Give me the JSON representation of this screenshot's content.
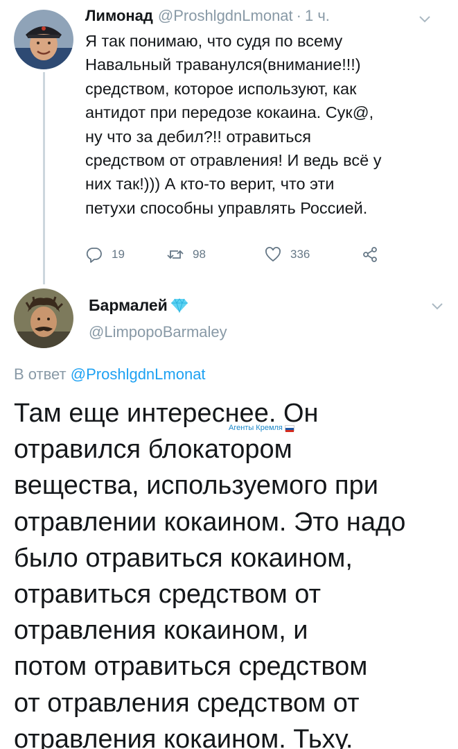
{
  "parent_tweet": {
    "name": "Лимонад",
    "handle": "@ProshlgdnLmonat",
    "separator": "·",
    "time": "1 ч.",
    "text_lines": [
      "Я так понимаю, что судя по всему",
      "Навальный траванулся(внимание!!!)",
      "средством, которое используют, как",
      "антидот при передозе кокаина. Сук@,",
      "ну что за дебил?!! отравиться",
      "средством от отравления! И ведь всё у",
      "них так!))) А кто-то верит, что эти",
      "петухи способны управлять Россией."
    ],
    "actions": {
      "replies": "19",
      "retweets": "98",
      "likes": "336"
    }
  },
  "reply_tweet": {
    "name": "Бармалей",
    "handle": "@LimpopoBarmaley",
    "reply_prefix": "В ответ",
    "reply_handle": "@ProshlgdnLmonat",
    "text_lines": [
      "Там еще интереснее. Он",
      "отравился блокатором",
      "вещества, используемого при",
      "отравлении кокаином. Это надо",
      "было отравиться кокаином,",
      "отравиться средством от",
      "отравления кокаином, и",
      "потом отравиться средством",
      "от отравления средством от",
      "отравления кокаином. Тьху."
    ]
  },
  "watermark": {
    "text": "Агенты Кремля"
  },
  "icons": {
    "reply": "reply-icon",
    "retweet": "retweet-icon",
    "like": "like-icon",
    "share": "share-icon",
    "menu": "chevron-down-icon",
    "badge": "diamond-icon"
  },
  "colors": {
    "text": "#14171a",
    "secondary": "#8899a6",
    "link": "#1da1f2",
    "thread_line": "#ccd6dd",
    "icon": "#657786",
    "badge": "#5fd3f3"
  }
}
